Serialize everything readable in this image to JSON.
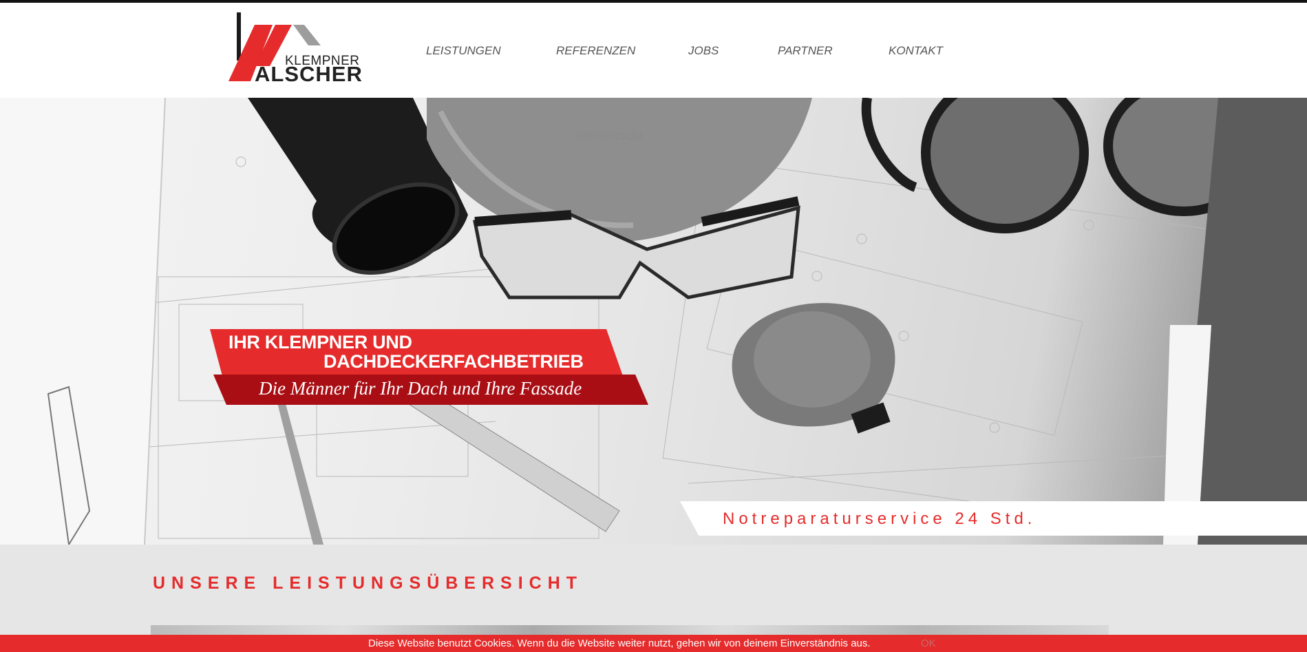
{
  "brand": {
    "logo_sub": "KLEMPNER",
    "logo_main": "ALSCHER"
  },
  "nav": {
    "items": [
      "LEISTUNGEN",
      "REFERENZEN",
      "JOBS",
      "PARTNER",
      "KONTAKT"
    ],
    "submenu_item": "IMPRESSUM"
  },
  "hero": {
    "claim_line1": "IHR KLEMPNER UND",
    "claim_line2": "DACHDECKERFACHBETRIEB",
    "tagline": "Die Männer für Ihr Dach und Ihre Fassade",
    "emergency": "Notreparaturservice 24 Std."
  },
  "services": {
    "title": "UNSERE LEISTUNGSÜBERSICHT"
  },
  "cookie": {
    "message": "Diese Website benutzt Cookies. Wenn du die Website weiter nutzt, gehen wir von deinem Einverständnis aus.",
    "ok_label": "OK"
  },
  "colors": {
    "accent": "#e52b2b",
    "accent_dark": "#a90e14",
    "text_dark": "#222222",
    "nav_text": "#555555"
  },
  "icons": {
    "logo": "roof-stripes-logo"
  }
}
